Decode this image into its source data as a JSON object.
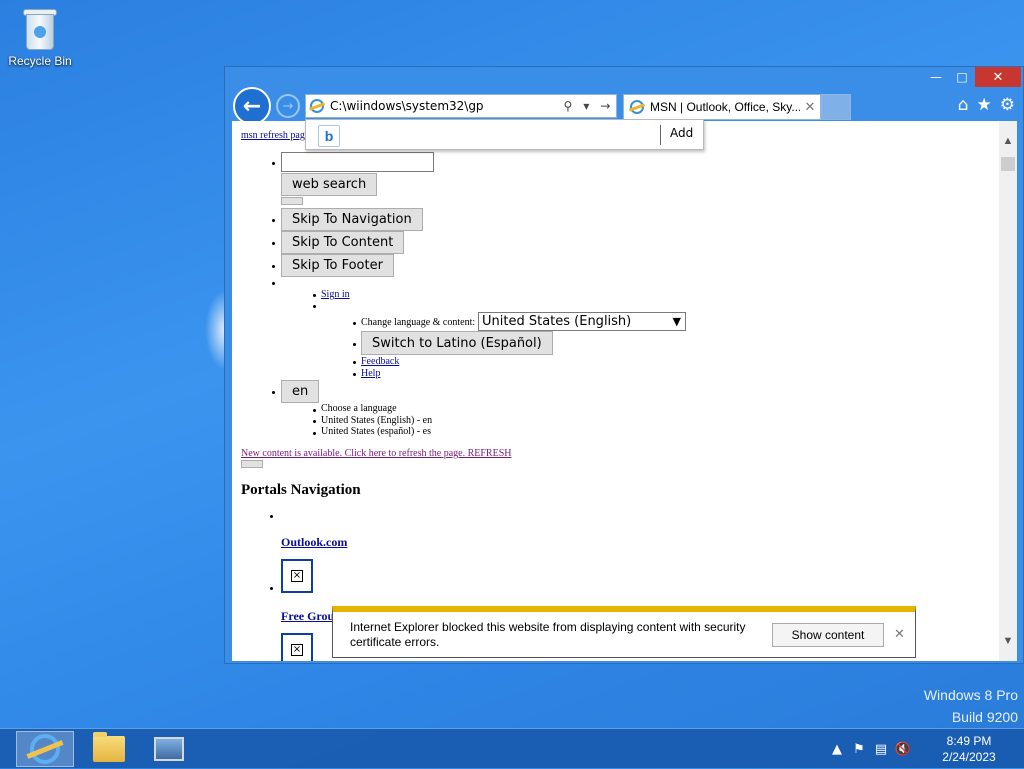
{
  "desktop": {
    "recycle_bin_label": "Recycle Bin",
    "watermark_line1": "Windows 8 Pro",
    "watermark_line2": "Build 9200"
  },
  "browser": {
    "address_value": "C:\\wiindows\\system32\\gp",
    "tab_title": "MSN | Outlook, Office, Sky...",
    "suggest_add_label": "Add",
    "suggest_bing_label": "b",
    "icons": [
      "back-arrow-icon",
      "forward-arrow-icon",
      "search-icon",
      "dropdown-icon",
      "go-arrow-icon",
      "home-icon",
      "favorites-star-icon",
      "settings-gear-icon"
    ]
  },
  "page": {
    "refresh_link": "msn refresh pag",
    "web_search_button": "web search",
    "skip_nav": "Skip To Navigation",
    "skip_content": "Skip To Content",
    "skip_footer": "Skip To Footer",
    "sign_in": "Sign in",
    "change_language_label": "Change language & content:",
    "language_select_value": "United States (English)",
    "switch_button": "Switch to Latino (Español)",
    "feedback": "Feedback",
    "help": "Help",
    "en_button": "en",
    "choose_language": "Choose a language",
    "lang_en": "United States (English) - en",
    "lang_es": "United States (español) - es",
    "new_content": "New content is available. Click here to refresh the page. REFRESH",
    "portals_heading": "Portals Navigation",
    "outlook_link": "Outlook.com",
    "free_group_link": "Free Grou"
  },
  "notification": {
    "message": "Internet Explorer blocked this website from displaying content with security certificate errors.",
    "show_content": "Show content"
  },
  "taskbar": {
    "time": "8:49 PM",
    "date": "2/24/2023"
  }
}
